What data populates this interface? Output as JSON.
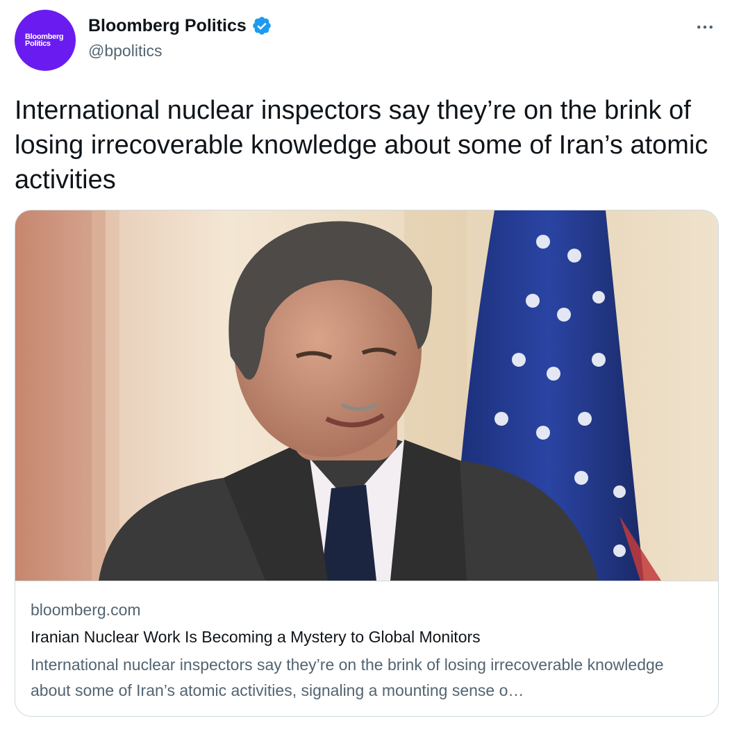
{
  "author": {
    "avatar_text_line1": "Bloomberg",
    "avatar_text_line2": "Politics",
    "display_name": "Bloomberg Politics",
    "handle": "@bpolitics",
    "verified": true
  },
  "tweet": {
    "text": "International nuclear inspectors say they’re on the brink of losing irrecoverable knowledge about some of Iran’s atomic activities"
  },
  "card": {
    "domain": "bloomberg.com",
    "title": "Iranian Nuclear Work Is Becoming a Mystery to Global Monitors",
    "description": "International nuclear inspectors say they’re on the brink of losing irrecoverable knowledge about some of Iran’s atomic activities, signaling a mounting sense o…"
  },
  "colors": {
    "avatar_bg": "#6a1cf0",
    "verified_badge": "#1d9bf0",
    "secondary_text": "#536471",
    "primary_text": "#0f1419",
    "border": "#cfd9de"
  },
  "icons": {
    "verified": "verified-badge-icon",
    "more": "more-horizontal-icon"
  }
}
